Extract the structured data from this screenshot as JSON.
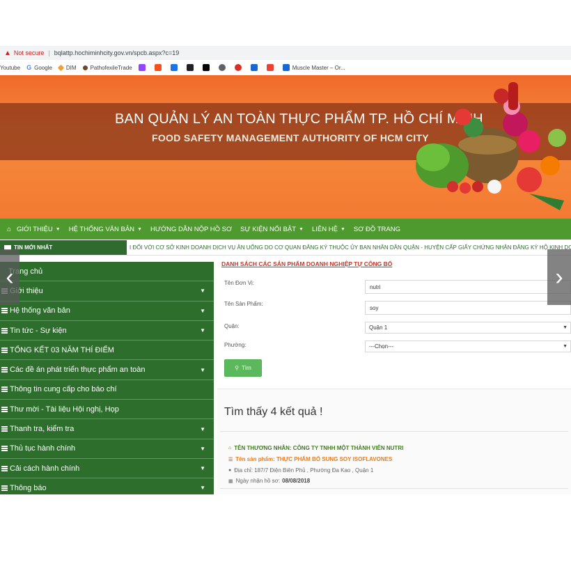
{
  "browser": {
    "security": "Not secure",
    "url": "bqlattp.hochiminhcity.gov.vn/spcb.aspx?c=19",
    "bookmarks": [
      "Youtube",
      "Google",
      "DIM",
      "PathofexileTrade",
      "Muscle Master – Or..."
    ]
  },
  "banner": {
    "title_vi": "BAN QUẢN LÝ AN TOÀN THỰC PHẨM TP. HỒ CHÍ MINH",
    "title_en": "FOOD SAFETY MANAGEMENT AUTHORITY OF HCM CITY"
  },
  "nav": {
    "items": [
      {
        "label": "GIỚI THIỆU",
        "dropdown": true
      },
      {
        "label": "HỆ THỐNG VĂN BẢN",
        "dropdown": true
      },
      {
        "label": "HƯỚNG DẪN NỘP HỒ SƠ",
        "dropdown": false
      },
      {
        "label": "SỰ KIỆN NỔI BẬT",
        "dropdown": true
      },
      {
        "label": "LIÊN HỆ",
        "dropdown": true
      },
      {
        "label": "SƠ ĐỒ TRANG",
        "dropdown": false
      }
    ]
  },
  "ticker": {
    "label": "TIN MỚI NHẤT",
    "message": "I ĐỐI VỚI CƠ SỞ KINH DOANH DỊCH VỤ ĂN UỐNG DO CƠ QUAN ĐĂNG KÝ THUỘC ỦY BAN NHÂN DÂN QUẬN - HUYỆN CẤP GIẤY CHỨNG NHẬN ĐĂNG KÝ HỘ KINH DOANH"
  },
  "sidebar": {
    "items": [
      {
        "label": "Trang chủ",
        "dropdown": false
      },
      {
        "label": "Giới thiệu",
        "dropdown": true
      },
      {
        "label": "Hệ thống văn bản",
        "dropdown": true
      },
      {
        "label": "Tin tức - Sự kiện",
        "dropdown": true
      },
      {
        "label": "TỔNG KẾT 03 NĂM THÍ ĐIỂM",
        "dropdown": false
      },
      {
        "label": "Các đề án phát triển thực phẩm an toàn",
        "dropdown": true
      },
      {
        "label": "Thông tin cung cấp cho báo chí",
        "dropdown": false
      },
      {
        "label": "Thư mời - Tài liệu Hội nghị, Họp",
        "dropdown": false
      },
      {
        "label": "Thanh tra, kiểm tra",
        "dropdown": true
      },
      {
        "label": "Thủ tục hành chính",
        "dropdown": true
      },
      {
        "label": "Cải cách hành chính",
        "dropdown": true
      },
      {
        "label": "Thông báo",
        "dropdown": true
      }
    ]
  },
  "search": {
    "heading": "DANH SÁCH CÁC SẢN PHẨM DOANH NGHIỆP TỰ CÔNG BỐ",
    "unit_label": "Tên Đơn Vị:",
    "unit_value": "nutri",
    "product_label": "Tên Sản Phẩm:",
    "product_value": "soy",
    "district_label": "Quận:",
    "district_value": "Quận 1",
    "ward_label": "Phường:",
    "ward_value": "---Chọn---",
    "button_label": "Tìm"
  },
  "results": {
    "count_text": "Tìm thấy 4 kết quả !",
    "first": {
      "trader": "TÊN THƯƠNG NHÂN: CÔNG TY TNHH MỘT THÀNH VIÊN NUTRI",
      "product": "Tên sản phẩm: THỰC PHẨM BỔ SUNG SOY ISOFLAVONES",
      "address": "Địa chỉ: 187/7 Điện Biên Phủ , Phường Đa Kao , Quận 1",
      "date_label": "Ngày nhận hồ sơ:",
      "date_value": "08/08/2018"
    }
  }
}
